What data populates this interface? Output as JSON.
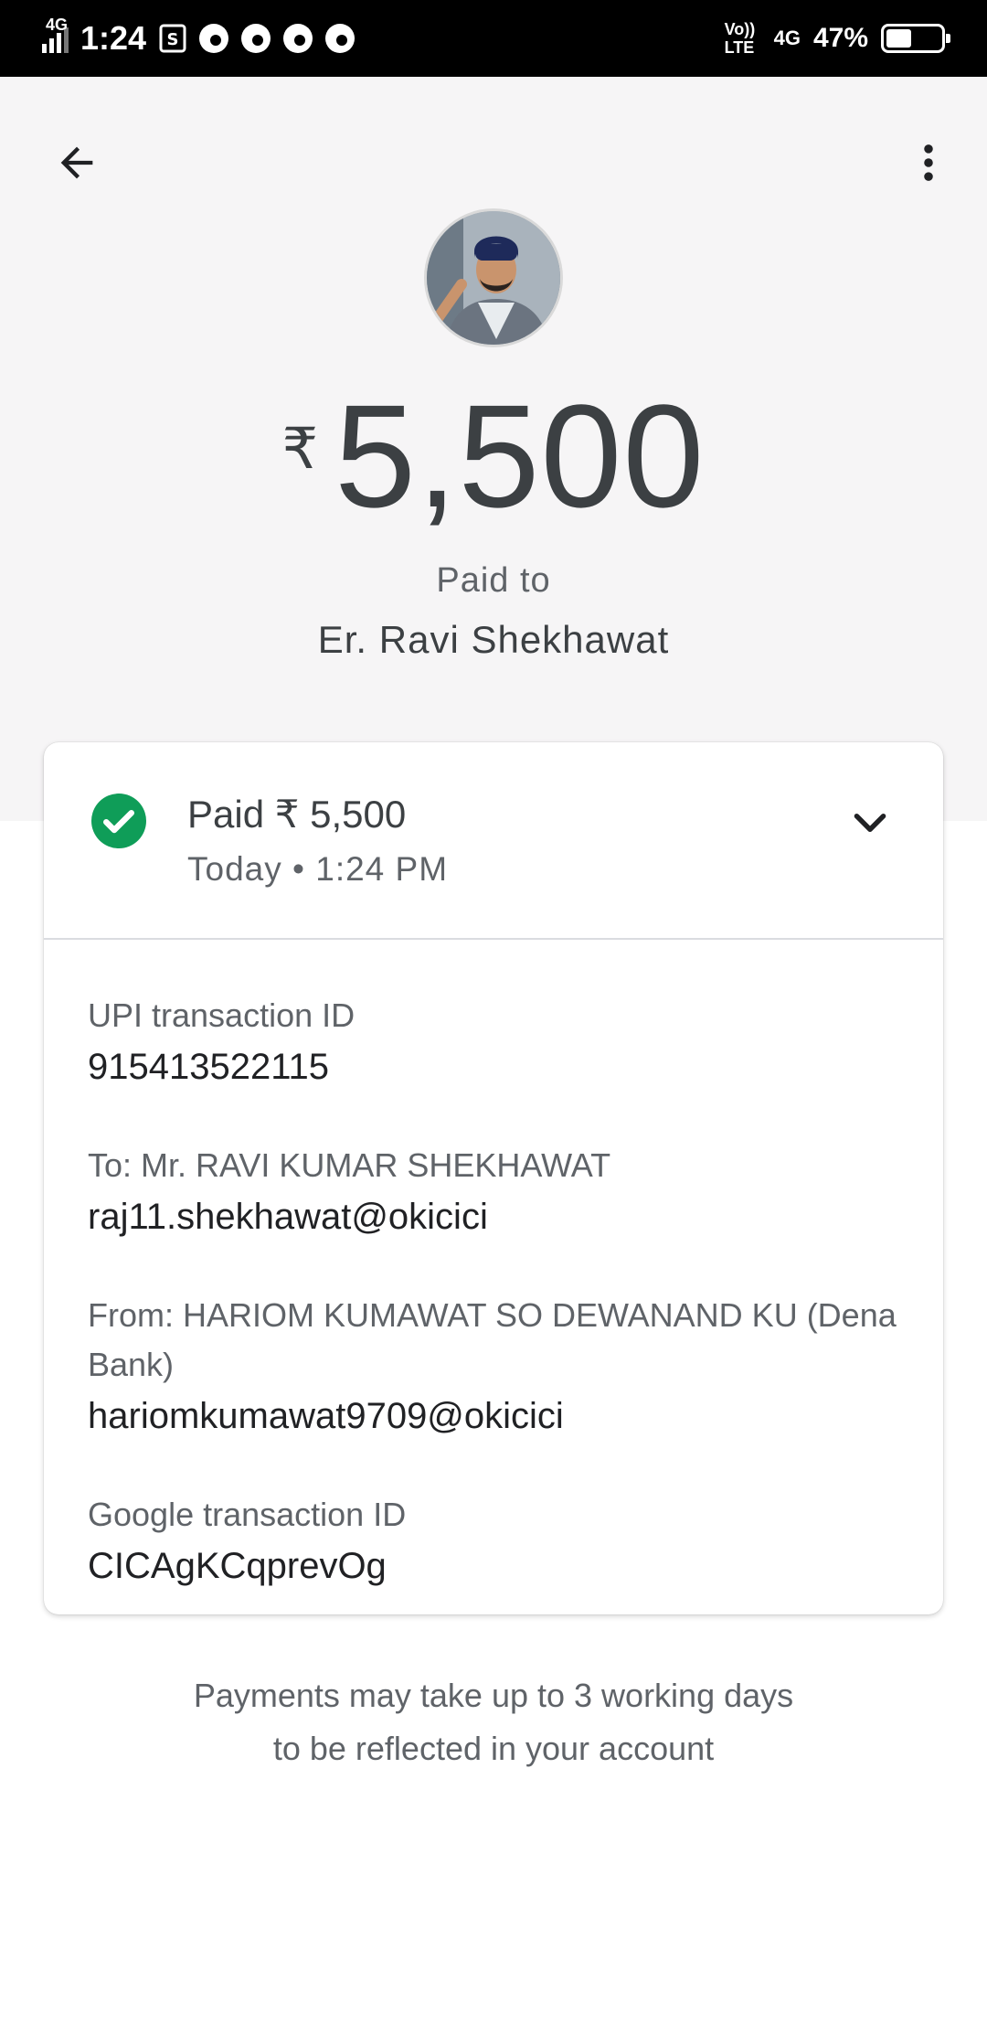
{
  "status_bar": {
    "network_left": "4G",
    "time": "1:24",
    "volte": "Vo)) LTE",
    "network_right": "4G",
    "battery_percent": "47%",
    "battery_level": 0.47
  },
  "header": {
    "back_icon": "arrow-back-icon",
    "more_icon": "more-vert-icon"
  },
  "payment": {
    "currency_symbol": "₹",
    "amount": "5,500",
    "paid_to_label": "Paid to",
    "payee_name": "Er. Ravi Shekhawat"
  },
  "card": {
    "status_line": "Paid ₹ 5,500",
    "time_line": "Today • 1:24 PM",
    "status_color": "#0f9d58",
    "details": [
      {
        "label": "UPI transaction ID",
        "value": "915413522115"
      },
      {
        "label": "To: Mr. RAVI KUMAR SHEKHAWAT",
        "value": "raj11.shekhawat@okicici"
      },
      {
        "label": "From: HARIOM KUMAWAT SO DEWANAND KU (Dena Bank)",
        "value": "hariomkumawat9709@okicici"
      },
      {
        "label": "Google transaction ID",
        "value": "CICAgKCqprevOg"
      }
    ]
  },
  "footer": {
    "line1": "Payments may take up to 3 working days",
    "line2": "to be reflected in your account"
  }
}
